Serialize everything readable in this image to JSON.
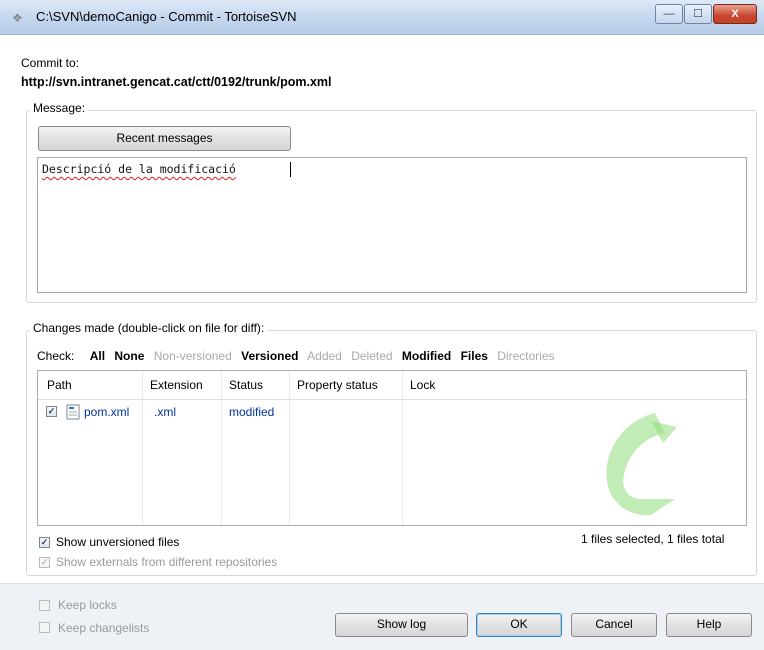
{
  "window": {
    "title": "C:\\SVN\\demoCanigo - Commit - TortoiseSVN",
    "controls": {
      "minimize": "—",
      "maximize": "☐",
      "close": "X"
    }
  },
  "commit_to": {
    "label": "Commit to:",
    "url": "http://svn.intranet.gencat.cat/ctt/0192/trunk/pom.xml"
  },
  "message": {
    "group_label": "Message:",
    "recent_button": "Recent messages",
    "text": "Descripció de la modificació"
  },
  "changes": {
    "group_label": "Changes made (double-click on file for diff):",
    "check_label": "Check:",
    "filters": [
      {
        "label": "All",
        "enabled": true
      },
      {
        "label": "None",
        "enabled": true
      },
      {
        "label": "Non-versioned",
        "enabled": false
      },
      {
        "label": "Versioned",
        "enabled": true
      },
      {
        "label": "Added",
        "enabled": false
      },
      {
        "label": "Deleted",
        "enabled": false
      },
      {
        "label": "Modified",
        "enabled": true
      },
      {
        "label": "Files",
        "enabled": true
      },
      {
        "label": "Directories",
        "enabled": false
      }
    ],
    "columns": [
      "Path",
      "Extension",
      "Status",
      "Property status",
      "Lock"
    ],
    "rows": [
      {
        "checked": true,
        "path": "pom.xml",
        "extension": ".xml",
        "status": "modified",
        "property_status": "",
        "lock": ""
      }
    ],
    "show_unversioned": {
      "label": "Show unversioned files",
      "checked": true
    },
    "show_externals": {
      "label": "Show externals from different repositories",
      "checked": true,
      "enabled": false
    },
    "selection_summary": "1 files selected, 1 files total"
  },
  "footer": {
    "keep_locks": {
      "label": "Keep locks",
      "checked": false
    },
    "keep_changelists": {
      "label": "Keep changelists",
      "checked": false
    },
    "buttons": {
      "show_log": "Show log",
      "ok": "OK",
      "cancel": "Cancel",
      "help": "Help"
    }
  },
  "colors": {
    "accent": "#0033a0",
    "disabled": "#a9a9a9",
    "watermark": "#8fdc7a"
  }
}
